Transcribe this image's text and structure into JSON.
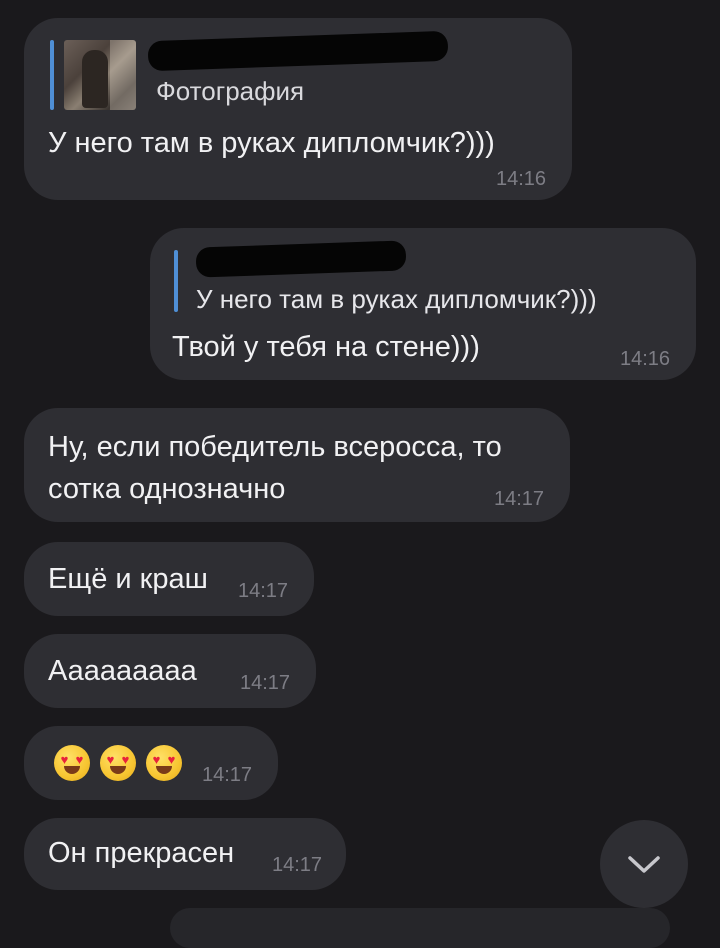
{
  "messages": [
    {
      "reply": {
        "label": "Фотография"
      },
      "text": "У него там в руках дипломчик?)))",
      "time": "14:16"
    },
    {
      "reply": {
        "text": "У него там в руках дипломчик?)))"
      },
      "text": "Твой у тебя на стене)))",
      "time": "14:16"
    },
    {
      "text_line1": "Ну, если победитель всеросса, то",
      "text_line2": "сотка однозначно",
      "time": "14:17"
    },
    {
      "text": "Ещё и краш",
      "time": "14:17"
    },
    {
      "text": "Ааааааааа",
      "time": "14:17"
    },
    {
      "emoji": [
        "heart-eyes-emoji",
        "heart-eyes-emoji",
        "heart-eyes-emoji"
      ],
      "time": "14:17"
    },
    {
      "text": "Он прекрасен",
      "time": "14:17"
    }
  ],
  "icons": {
    "scroll_down": "chevron-down-icon"
  },
  "colors": {
    "background": "#1a191c",
    "bubble": "#2e2e33",
    "reply_accent": "#4f8fd6",
    "time": "#7d7d85"
  }
}
